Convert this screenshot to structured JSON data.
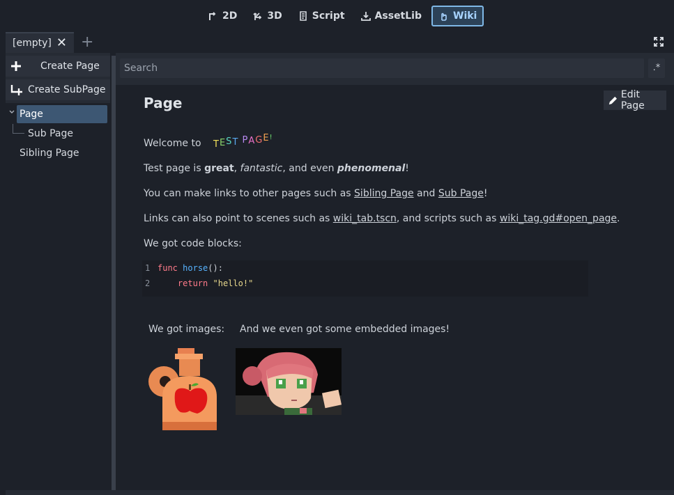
{
  "workspaces": [
    {
      "label": "2D",
      "icon": "2d-icon",
      "active": false
    },
    {
      "label": "3D",
      "icon": "3d-icon",
      "active": false
    },
    {
      "label": "Script",
      "icon": "script-icon",
      "active": false
    },
    {
      "label": "AssetLib",
      "icon": "download-icon",
      "active": false
    },
    {
      "label": "Wiki",
      "icon": "wiki-icon",
      "active": true
    }
  ],
  "tab": {
    "label": "[empty]",
    "close_icon": "close-icon",
    "add_icon": "plus-icon"
  },
  "sidebar": {
    "create_page": "Create Page",
    "create_subpage": "Create SubPage",
    "tree": [
      {
        "label": "Page",
        "selected": true
      },
      {
        "label": "Sub Page",
        "selected": false
      },
      {
        "label": "Sibling Page",
        "selected": false
      }
    ]
  },
  "search": {
    "placeholder": "Search",
    "regex_label": ".*"
  },
  "page": {
    "title": "Page",
    "edit_label": "Edit Page",
    "welcome": "Welcome to",
    "fancy_text": "TEST PAGE!",
    "p1_a": "Test page is ",
    "p1_b": "great",
    "p1_c": ", ",
    "p1_d": "fantastic",
    "p1_e": ", and even ",
    "p1_f": "phenomenal",
    "p1_g": "!",
    "p2_a": "You can make links to other pages such as ",
    "p2_link1": "Sibling Page",
    "p2_b": " and ",
    "p2_link2": "Sub Page",
    "p2_c": "!",
    "p3_a": "Links can also point to scenes such as ",
    "p3_link1": "wiki_tab.tscn",
    "p3_b": ", and scripts such as ",
    "p3_link2": "wiki_tag.gd#open_page",
    "p3_c": ".",
    "p4": "We got code blocks:",
    "code": [
      {
        "num": "1",
        "kw": "func",
        "fn": "horse",
        "rest": "():"
      },
      {
        "num": "2",
        "kw": "return",
        "str": "\"hello!\""
      }
    ],
    "images_label": "We got images:",
    "embedded_label": "And we even got some embedded images!"
  }
}
